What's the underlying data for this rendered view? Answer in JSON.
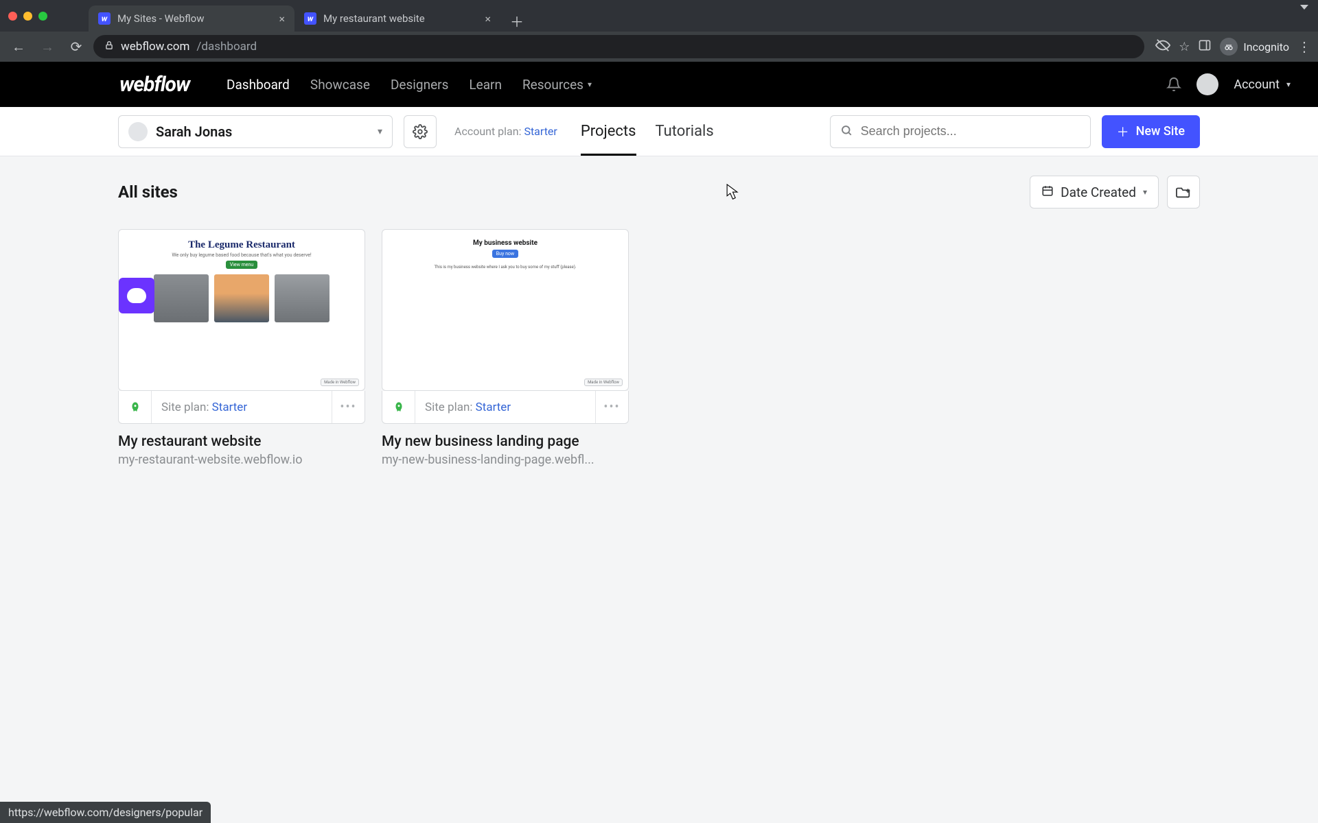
{
  "browser": {
    "tabs": [
      {
        "title": "My Sites - Webflow",
        "active": true
      },
      {
        "title": "My restaurant website",
        "active": false
      }
    ],
    "url_host": "webflow.com",
    "url_path": "/dashboard",
    "incognito_label": "Incognito"
  },
  "topnav": {
    "logo": "webflow",
    "items": [
      "Dashboard",
      "Showcase",
      "Designers",
      "Learn",
      "Resources"
    ],
    "active": "Dashboard",
    "account_label": "Account"
  },
  "workspace": {
    "user_name": "Sarah Jonas",
    "plan_label": "Account plan:",
    "plan_value": "Starter",
    "tabs": [
      "Projects",
      "Tutorials"
    ],
    "active_tab": "Projects",
    "search_placeholder": "Search projects...",
    "new_site_label": "New Site"
  },
  "content": {
    "title": "All sites",
    "sort_label": "Date Created"
  },
  "sites": [
    {
      "title": "My restaurant website",
      "url": "my-restaurant-website.webflow.io",
      "plan_label": "Site plan:",
      "plan_value": "Starter",
      "thumb": {
        "heading": "The Legume Restaurant",
        "sub": "We only buy legume based food because that's what you deserve!",
        "pill": "View menu",
        "made_in": "Made in Webflow"
      }
    },
    {
      "title": "My new business landing page",
      "url": "my-new-business-landing-page.webfl...",
      "plan_label": "Site plan:",
      "plan_value": "Starter",
      "thumb": {
        "heading": "My business website",
        "pill": "Buy now",
        "desc": "This is my business website where I ask you to buy some of my stuff (please).",
        "made_in": "Made in Webflow"
      }
    }
  ],
  "status_url": "https://webflow.com/designers/popular"
}
